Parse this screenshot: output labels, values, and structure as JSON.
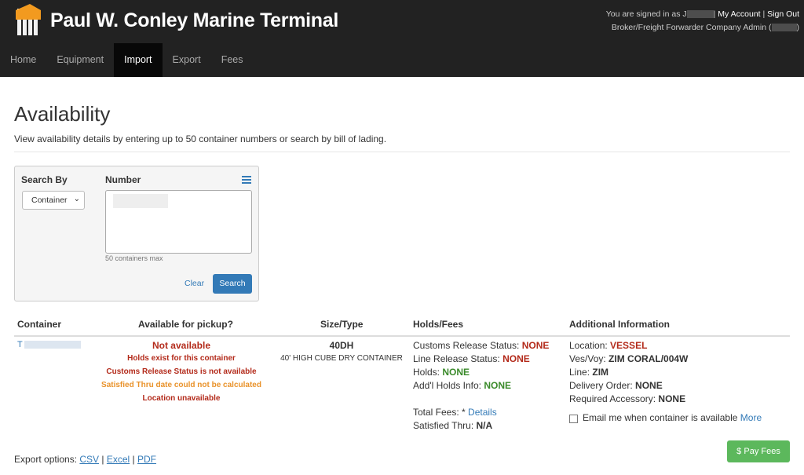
{
  "header": {
    "title": "Paul W. Conley Marine Terminal",
    "signed_in_prefix": "You are signed in as J",
    "my_account": "My Account",
    "sign_out": "Sign Out",
    "role": "Broker/Freight Forwarder Company Admin ("
  },
  "nav": {
    "items": [
      {
        "label": "Home"
      },
      {
        "label": "Equipment"
      },
      {
        "label": "Import"
      },
      {
        "label": "Export"
      },
      {
        "label": "Fees"
      }
    ],
    "active": "Import"
  },
  "page": {
    "title": "Availability",
    "description": "View availability details by entering up to 50 container numbers or search by bill of lading."
  },
  "search": {
    "search_by_label": "Search By",
    "search_by_value": "Container",
    "number_label": "Number",
    "hint": "50 containers max",
    "clear_label": "Clear",
    "search_label": "Search"
  },
  "table": {
    "headers": {
      "container": "Container",
      "available": "Available for pickup?",
      "size_type": "Size/Type",
      "holds_fees": "Holds/Fees",
      "additional": "Additional Information"
    },
    "row": {
      "container_prefix": "T",
      "available_status": "Not available",
      "available_notes": [
        "Holds exist for this container",
        "Customs Release Status is not available",
        "Satisfied Thru date could not be calculated",
        "Location unavailable"
      ],
      "size": "40DH",
      "type": "40' HIGH CUBE DRY CONTAINER",
      "holds": {
        "customs_label": "Customs Release Status:",
        "customs_value": "NONE",
        "line_label": "Line Release Status:",
        "line_value": "NONE",
        "holds_label": "Holds:",
        "holds_value": "NONE",
        "addl_label": "Add'l Holds Info:",
        "addl_value": "NONE",
        "total_fees_label": "Total Fees: *",
        "details_link": "Details",
        "satisfied_label": "Satisfied Thru:",
        "satisfied_value": "N/A"
      },
      "additional": {
        "location_label": "Location:",
        "location_value": "VESSEL",
        "vesvoy_label": "Ves/Voy:",
        "vesvoy_value": "ZIM CORAL/004W",
        "line_label": "Line:",
        "line_value": "ZIM",
        "delivery_label": "Delivery Order:",
        "delivery_value": "NONE",
        "accessory_label": "Required Accessory:",
        "accessory_value": "NONE",
        "email_label": "Email me when container is available",
        "more_link": "More"
      }
    }
  },
  "footer": {
    "export_label": "Export options:",
    "csv": "CSV",
    "excel": "Excel",
    "pdf": "PDF",
    "pay_fees": "Pay Fees"
  },
  "colors": {
    "header_bg": "#222222",
    "accent": "#337ab7",
    "danger": "#b32a1a",
    "warning": "#e9922a",
    "success": "#3a8a2a",
    "pay_button": "#5cb85c"
  }
}
